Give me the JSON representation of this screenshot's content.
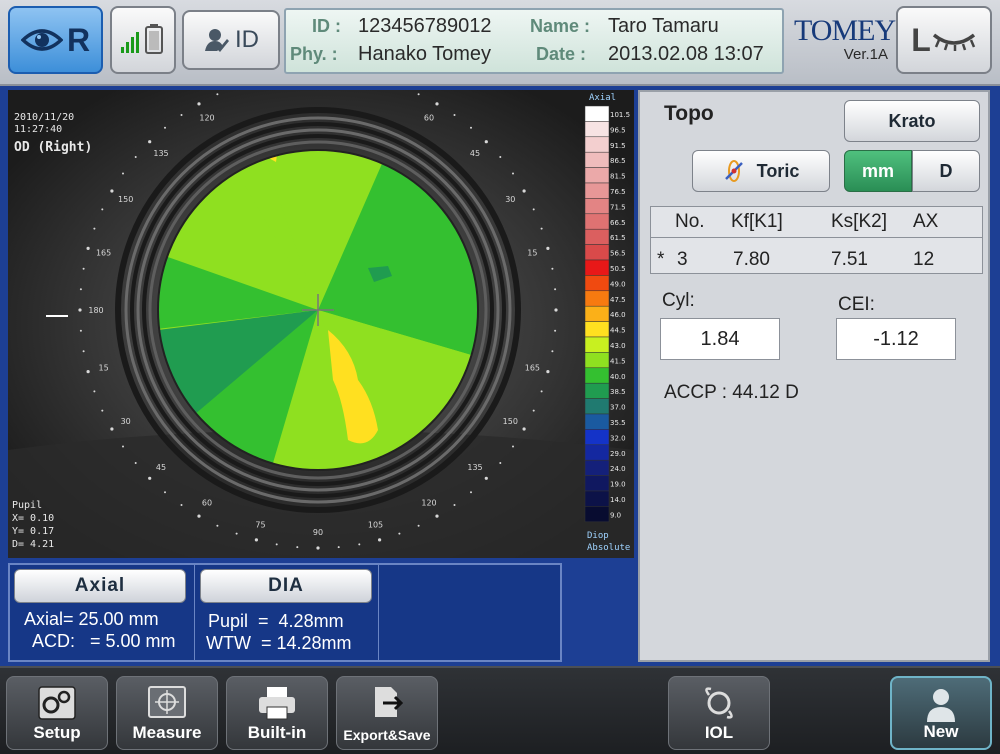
{
  "header": {
    "od_label": "R",
    "id_button_label": "ID",
    "id_key": "ID :",
    "id_value": "123456789012",
    "name_key": "Name :",
    "name_value": "Taro Tamaru",
    "phy_key": "Phy. :",
    "phy_value": "Hanako Tomey",
    "date_key": "Date :",
    "date_value": "2013.02.08  13:07",
    "brand": "TOMEY",
    "version": "Ver.1A",
    "os_label": "L"
  },
  "map": {
    "overlay_date": "2010/11/20",
    "overlay_time": "11:27:40",
    "overlay_eye": "OD (Right)",
    "pupil_label": "Pupil",
    "pupil_x": "X=  0.10",
    "pupil_y": "Y=  0.17",
    "pupil_d": "D=  4.21",
    "scale_top_label": "Axial",
    "scale_bottom_label1": "Diop",
    "scale_bottom_label2": "Absolute",
    "scale_values": [
      "101.5",
      "96.5",
      "91.5",
      "86.5",
      "81.5",
      "76.5",
      "71.5",
      "66.5",
      "61.5",
      "56.5",
      "50.5",
      "49.0",
      "47.5",
      "46.0",
      "44.5",
      "43.0",
      "41.5",
      "40.0",
      "38.5",
      "37.0",
      "35.5",
      "32.0",
      "29.0",
      "24.0",
      "19.0",
      "14.0",
      "9.0"
    ],
    "scale_colors": [
      "#ffffff",
      "#f7e3e3",
      "#f3cfcf",
      "#efbcbc",
      "#eba9a9",
      "#e79797",
      "#e38484",
      "#df7272",
      "#db5f5f",
      "#d94a4a",
      "#e81818",
      "#f04a10",
      "#f77a10",
      "#fbb018",
      "#ffe020",
      "#c8f020",
      "#8fe020",
      "#34c030",
      "#209c50",
      "#207a70",
      "#1a5aa0",
      "#1433c8",
      "#1428a0",
      "#14207a",
      "#101860",
      "#0c1248",
      "#080c30"
    ],
    "angle_labels": [
      "90",
      "105",
      "120",
      "135",
      "150",
      "165",
      "180",
      "15",
      "30",
      "45",
      "60",
      "75",
      "90",
      "105",
      "120",
      "135",
      "150",
      "165",
      "60",
      "45",
      "30",
      "15"
    ]
  },
  "topo": {
    "title": "Topo",
    "krato_label": "Krato",
    "toric_label": "Toric",
    "mm_label": "mm",
    "d_label": "D",
    "table_headers": [
      "No.",
      "Kf[K1]",
      "Ks[K2]",
      "AX"
    ],
    "row": {
      "mark": "*",
      "no": "3",
      "kf": "7.80",
      "ks": "7.51",
      "ax": "12"
    },
    "cyl_label": "Cyl:",
    "cyl_value": "1.84",
    "cei_label": "CEI:",
    "cei_value": "-1.12",
    "accp": "ACCP : 44.12 D"
  },
  "bottom": {
    "axial_button": "Axial",
    "dia_button": "DIA",
    "axial_line": "Axial= 25.00 mm",
    "acd_line": "ACD:   = 5.00 mm",
    "pupil_line": "Pupil  =  4.28mm",
    "wtw_line": "WTW  = 14.28mm"
  },
  "footer": {
    "setup": "Setup",
    "measure": "Measure",
    "builtin": "Built-in",
    "export": "Export&Save",
    "iol": "IOL",
    "new": "New"
  },
  "colors": {
    "header_bg": "#c8ccd2",
    "od_active": "#4a9ae0",
    "panel_blue": "#163787",
    "right_panel": "#d4d7dc",
    "toggle_active": "#2f9e5e"
  }
}
